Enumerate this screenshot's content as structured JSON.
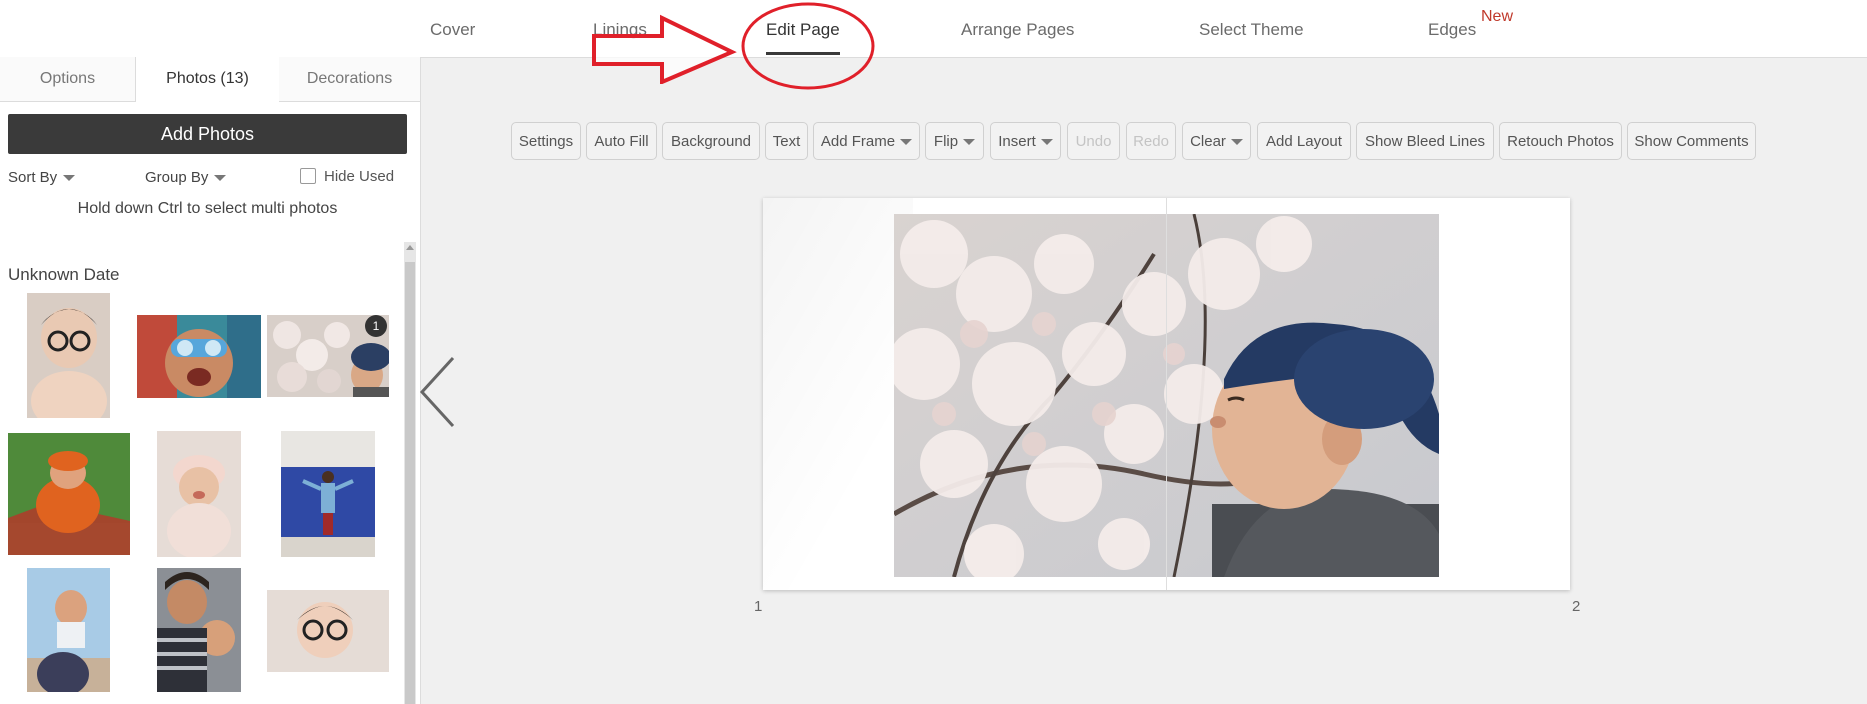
{
  "nav": {
    "tabs": [
      {
        "label": "Cover"
      },
      {
        "label": "Linings"
      },
      {
        "label": "Edit Page"
      },
      {
        "label": "Arrange Pages"
      },
      {
        "label": "Select Theme"
      },
      {
        "label": "Edges"
      }
    ],
    "active_tab": "Edit Page",
    "new_badge": "New"
  },
  "panel": {
    "tabs": [
      {
        "label": "Options"
      },
      {
        "label": "Photos (13)"
      },
      {
        "label": "Decorations"
      }
    ],
    "active_tab": "Photos (13)",
    "add_photos_label": "Add Photos",
    "sort_by_label": "Sort By",
    "group_by_label": "Group By",
    "hide_used_label": "Hide Used",
    "hide_used_checked": false,
    "hint": "Hold down Ctrl to select multi photos",
    "date_group": "Unknown Date",
    "photos": [
      {
        "subject": "baby with round glasses",
        "used": false
      },
      {
        "subject": "child in swim goggles",
        "used": false
      },
      {
        "subject": "boy under cherry blossoms",
        "used": true,
        "badge": "1"
      },
      {
        "subject": "baby in orange pumpkin costume",
        "used": false
      },
      {
        "subject": "baby in pink hat",
        "used": false
      },
      {
        "subject": "child by blue wall",
        "used": false
      },
      {
        "subject": "baby lifted in the air",
        "used": false
      },
      {
        "subject": "parent hugging child",
        "used": false
      },
      {
        "subject": "baby with round glasses lying down",
        "used": false
      }
    ]
  },
  "toolbar": {
    "buttons": [
      {
        "label": "Settings"
      },
      {
        "label": "Auto Fill"
      },
      {
        "label": "Background"
      },
      {
        "label": "Text"
      },
      {
        "label": "Add Frame",
        "dropdown": true
      },
      {
        "label": "Flip",
        "dropdown": true
      },
      {
        "label": "Insert",
        "dropdown": true
      },
      {
        "label": "Undo",
        "disabled": true
      },
      {
        "label": "Redo",
        "disabled": true
      },
      {
        "label": "Clear",
        "dropdown": true
      },
      {
        "label": "Add Layout"
      },
      {
        "label": "Show Bleed Lines"
      },
      {
        "label": "Retouch Photos"
      },
      {
        "label": "Show Comments"
      }
    ]
  },
  "canvas": {
    "left_page_number": "1",
    "right_page_number": "2",
    "photo_subject": "boy in blue cap smelling cherry blossoms"
  },
  "colors": {
    "accent_dark": "#3a3a3a",
    "new_badge": "#c0392b",
    "annotation_red": "#e0202a"
  }
}
